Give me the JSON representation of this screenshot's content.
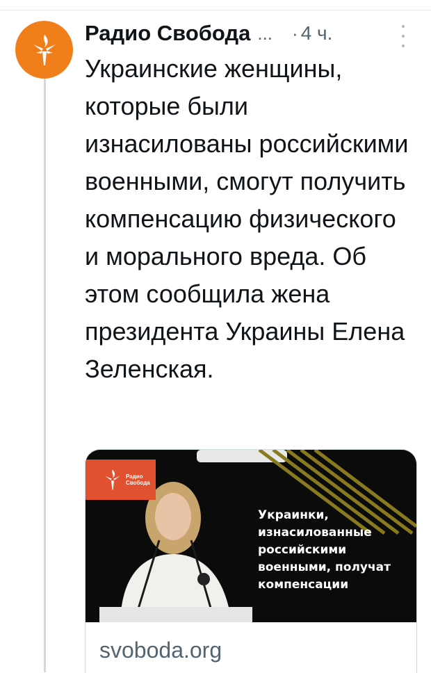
{
  "tweet": {
    "author_name": "Радио Свобода",
    "ellipsis": "...",
    "separator": "·",
    "time": "4 ч.",
    "avatar_icon": "radio-svoboda-torch-icon",
    "more_icon": "vertical-dots-icon",
    "text": "Украинские женщины, которые были изнасилованы российскими военными, смогут получить компенсацию физического и морального вреда. Об этом сообщила жена президента Украины Елена Зеленская."
  },
  "card": {
    "logo_text_line1": "Радио",
    "logo_text_line2": "Свобода",
    "headline": "Украинки, изнасилованные российскими военными, получат компенсации",
    "domain": "svoboda.org"
  },
  "colors": {
    "brand_orange": "#f07f1b",
    "badge_red": "#e1502f",
    "muted_text": "#536471"
  }
}
